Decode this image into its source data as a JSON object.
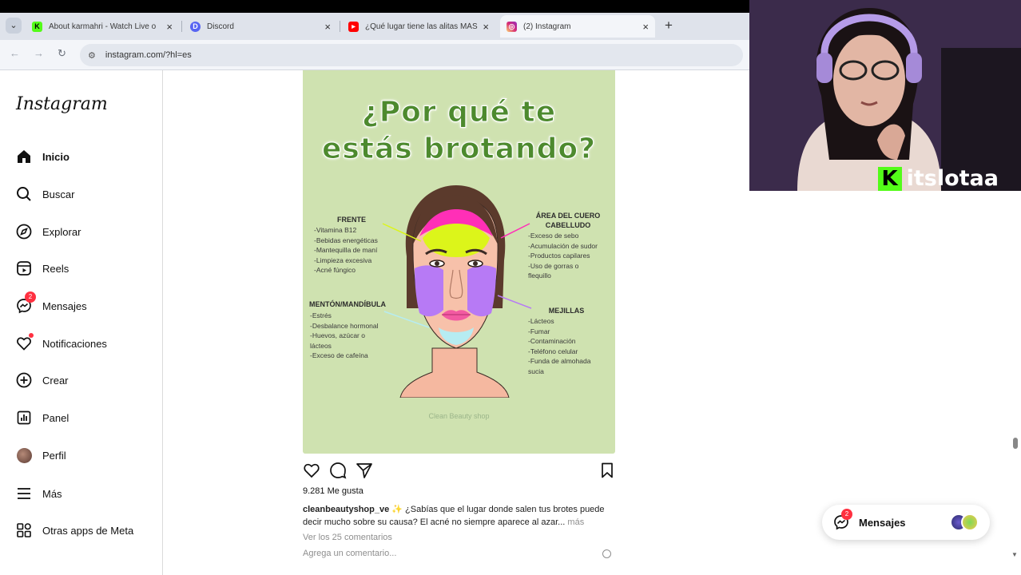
{
  "browser": {
    "tabs": [
      {
        "title": "About karmahri - Watch Live o",
        "favicon_color": "#53fc18",
        "favicon_char": "K"
      },
      {
        "title": "Discord",
        "favicon_color": "#5865f2",
        "favicon_char": "D"
      },
      {
        "title": "¿Qué lugar tiene las alitas MÁS",
        "favicon_color": "#ff0000",
        "favicon_char": "▶"
      },
      {
        "title": "(2) Instagram",
        "favicon_color": "#d6249f",
        "favicon_char": "◎"
      }
    ],
    "url": "instagram.com/?hl=es"
  },
  "sidebar": {
    "logo": "Instagram",
    "items": [
      {
        "label": "Inicio",
        "icon": "home-icon"
      },
      {
        "label": "Buscar",
        "icon": "search-icon"
      },
      {
        "label": "Explorar",
        "icon": "compass-icon"
      },
      {
        "label": "Reels",
        "icon": "reels-icon"
      },
      {
        "label": "Mensajes",
        "icon": "messenger-icon",
        "badge": "2"
      },
      {
        "label": "Notificaciones",
        "icon": "heart-icon"
      },
      {
        "label": "Crear",
        "icon": "plus-square-icon"
      },
      {
        "label": "Panel",
        "icon": "dashboard-icon"
      },
      {
        "label": "Perfil",
        "icon": "avatar"
      },
      {
        "label": "Más",
        "icon": "menu-icon"
      },
      {
        "label": "Otras apps de Meta",
        "icon": "apps-icon"
      }
    ]
  },
  "post": {
    "image": {
      "title_line1": "¿Por qué te",
      "title_line2": "estás brotando?",
      "frente": {
        "title": "FRENTE",
        "items": [
          "-Vitamina B12",
          "-Bebidas energéticas",
          "-Mantequilla de maní",
          "-Limpieza excesiva",
          "-Acné fúngico"
        ]
      },
      "cuero": {
        "title_line1": "ÁREA DEL CUERO",
        "title_line2": "CABELLUDO",
        "items": [
          "-Exceso de sebo",
          "-Acumulación de sudor",
          "-Productos capilares",
          "-Uso de gorras o",
          "flequillo"
        ]
      },
      "menton": {
        "title": "MENTÓN/MANDÍBULA",
        "items": [
          "-Estrés",
          "-Desbalance hormonal",
          "-Huevos, azúcar o",
          "lácteos",
          "-Exceso de cafeína"
        ]
      },
      "mejillas": {
        "title": "MEJILLAS",
        "items": [
          "-Lácteos",
          "-Fumar",
          "-Contaminación",
          "-Teléfono celular",
          "-Funda de almohada",
          "sucia"
        ]
      },
      "watermark": "Clean Beauty shop"
    },
    "likes": "9.281 Me gusta",
    "caption_user": "cleanbeautyshop_ve",
    "caption_text": " ✨ ¿Sabías que el lugar donde salen tus brotes puede decir mucho sobre su causa? El acné no siempre aparece al azar...",
    "caption_more": " más",
    "view_comments": "Ver los 25 comentarios",
    "add_comment_placeholder": "Agrega un comentario..."
  },
  "webcam": {
    "handle": "itslotaa"
  },
  "messages_pill": {
    "label": "Mensajes",
    "badge": "2"
  }
}
